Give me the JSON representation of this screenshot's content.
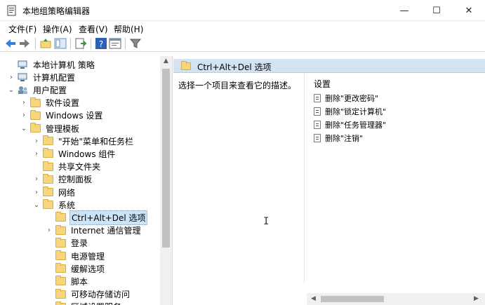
{
  "window": {
    "title": "本地组策略编辑器",
    "min": "—",
    "max": "☐",
    "close": "✕"
  },
  "menu": [
    "文件(F)",
    "操作(A)",
    "查看(V)",
    "帮助(H)"
  ],
  "toolbar": [
    "back-arrow-icon",
    "forward-arrow-icon",
    "folder-up-icon",
    "show-hide-tree-icon",
    "export-list-icon",
    "help-icon",
    "properties-icon",
    "filter-icon"
  ],
  "tree": [
    {
      "label": "本地计算机 策略",
      "chev": "",
      "icon": "computer-policy-icon"
    },
    {
      "label": "计算机配置",
      "chev": "›",
      "icon": "computer-icon"
    },
    {
      "label": "用户配置",
      "chev": "⌄",
      "icon": "user-icon"
    },
    {
      "label": "软件设置",
      "chev": "›",
      "icon": "folder-icon"
    },
    {
      "label": "Windows 设置",
      "chev": "›",
      "icon": "folder-icon"
    },
    {
      "label": "管理模板",
      "chev": "⌄",
      "icon": "folder-icon"
    },
    {
      "label": "\"开始\"菜单和任务栏",
      "chev": "›",
      "icon": "folder-icon"
    },
    {
      "label": "Windows 组件",
      "chev": "›",
      "icon": "folder-icon"
    },
    {
      "label": "共享文件夹",
      "chev": "",
      "icon": "folder-icon"
    },
    {
      "label": "控制面板",
      "chev": "›",
      "icon": "folder-icon"
    },
    {
      "label": "网络",
      "chev": "›",
      "icon": "folder-icon"
    },
    {
      "label": "系统",
      "chev": "⌄",
      "icon": "folder-icon"
    },
    {
      "label": "Ctrl+Alt+Del 选项",
      "chev": "",
      "icon": "folder-open-icon"
    },
    {
      "label": "Internet 通信管理",
      "chev": "›",
      "icon": "folder-icon"
    },
    {
      "label": "登录",
      "chev": "",
      "icon": "folder-icon"
    },
    {
      "label": "电源管理",
      "chev": "",
      "icon": "folder-icon"
    },
    {
      "label": "缓解选项",
      "chev": "",
      "icon": "folder-icon"
    },
    {
      "label": "脚本",
      "chev": "",
      "icon": "folder-icon"
    },
    {
      "label": "可移动存储访问",
      "chev": "",
      "icon": "folder-icon"
    },
    {
      "label": "区域设置服务",
      "chev": "",
      "icon": "folder-icon"
    }
  ],
  "right": {
    "header": "Ctrl+Alt+Del 选项",
    "description": "选择一个项目来查看它的描述。",
    "column_header": "设置",
    "settings": [
      "删除\"更改密码\"",
      "删除\"锁定计算机\"",
      "删除\"任务管理器\"",
      "删除\"注销\""
    ]
  },
  "colors": {
    "header_bg": "#d3e3f2",
    "selection": "#cce4f7",
    "folder": "#f6d57b"
  }
}
